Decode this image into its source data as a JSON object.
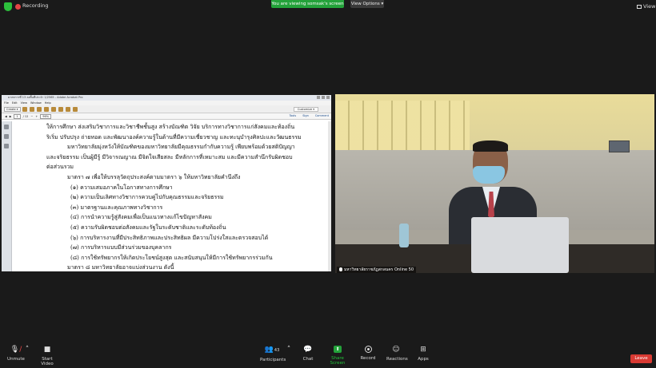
{
  "topbar": {
    "recording_label": "Recording",
    "banner_text": "You are viewing somsak's screen",
    "view_options_label": "View Options",
    "view_label": "View"
  },
  "pdf_window": {
    "title": "มาตรการที่ 13 ลงพื้นที่ประจำ 1/2565 - Adobe Acrobat Pro",
    "menu": [
      "File",
      "Edit",
      "View",
      "Window",
      "Help"
    ],
    "create_label": "Create",
    "customize_label": "Customize",
    "page_current": "1",
    "page_total": "/ 12",
    "zoom": "96%",
    "tools_label": "Tools",
    "sign_label": "Sign",
    "comment_label": "Comment"
  },
  "document": {
    "lines": [
      {
        "text": "ให้การศึกษา ส่งเสริมวิชาการและวิชาชีพชั้นสูง สร้างบัณฑิต วิจัย บริการทางวิชาการแก่สังคมและท้องถิ่น",
        "indent": ""
      },
      {
        "text": "ริเริ่ม ปรับปรุง ถ่ายทอด และพัฒนาองค์ความรู้ในด้านที่มีความเชี่ยวชาญ และทะนุบำรุงศิลปะและวัฒนธรรม",
        "indent": ""
      },
      {
        "text": "มหาวิทยาลัยมุ่งหวังให้บัณฑิตของมหาวิทยาลัยมีคุณธรรมกำกับความรู้ เพียบพร้อมด้วยสติปัญญา",
        "indent": "ind1"
      },
      {
        "text": "และจริยธรรม เป็นผู้มีรู้ มีวิจารณญาณ มีจิตใจเสียสละ มีหลักการที่เหมาะสม และมีความสำนึกรับผิดชอบ",
        "indent": ""
      },
      {
        "text": "ต่อส่วนรวม",
        "indent": ""
      },
      {
        "text": "มาตรา ๗ เพื่อให้บรรลุวัตถุประสงค์ตามมาตรา ๖ ให้มหาวิทยาลัยคำนึงถึง",
        "indent": "ind1"
      },
      {
        "text": "(๑) ความเสมอภาคในโอกาสทางการศึกษา",
        "indent": "ind2"
      },
      {
        "text": "(๒) ความเป็นเลิศทางวิชาการควบคู่ไปกับคุณธรรมและจริยธรรม",
        "indent": "ind2"
      },
      {
        "text": "(๓) มาตรฐานและคุณภาพทางวิชาการ",
        "indent": "ind2"
      },
      {
        "text": "(๔) การนำความรู้สู่สังคมเพื่อเป็นแนวทางแก้ไขปัญหาสังคม",
        "indent": "ind2"
      },
      {
        "text": "(๕) ความรับผิดชอบต่อสังคมและรัฐในระดับชาติและระดับท้องถิ่น",
        "indent": "ind2"
      },
      {
        "text": "(๖) การบริหารงานที่มีประสิทธิภาพและประสิทธิผล มีความโปร่งใสและตรวจสอบได้",
        "indent": "ind2"
      },
      {
        "text": "(๗) การบริหารแบบมีส่วนร่วมของบุคลากร",
        "indent": "ind2"
      },
      {
        "text": "(๘) การใช้ทรัพยากรให้เกิดประโยชน์สูงสุด และสนับสนุนให้มีการใช้ทรัพยากรร่วมกัน",
        "indent": "ind2"
      },
      {
        "text": "มาตรา ๘ มหาวิทยาลัยอาจแบ่งส่วนงาน ดังนี้",
        "indent": "ind1"
      }
    ]
  },
  "camera": {
    "participant_name": "มหาวิทยาลัยราชภัฏสกลนคร Online 50"
  },
  "controls": {
    "unmute": "Unmute",
    "start_video": "Start Video",
    "participants": "Participants",
    "participants_count": "43",
    "chat": "Chat",
    "share_screen": "Share Screen",
    "record": "Record",
    "reactions": "Reactions",
    "apps": "Apps",
    "leave": "Leave"
  }
}
